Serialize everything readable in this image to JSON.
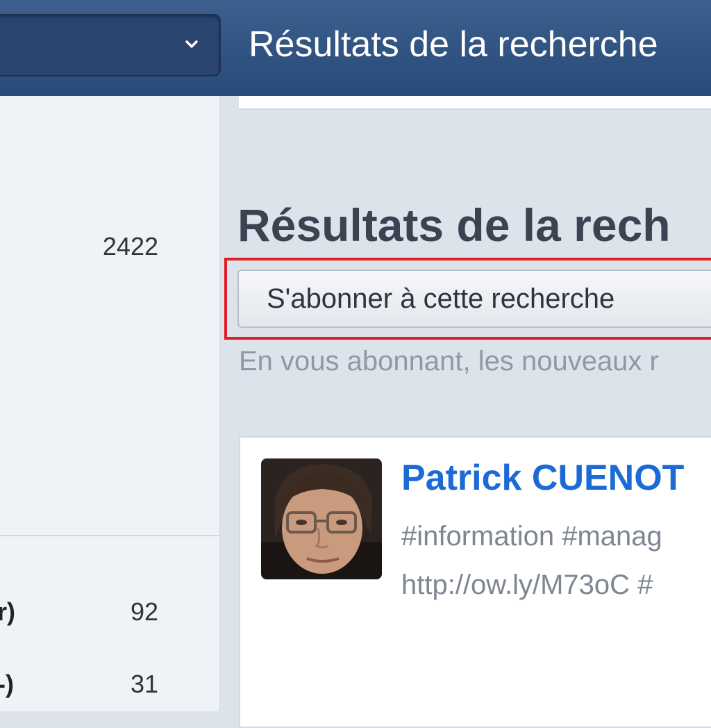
{
  "header": {
    "title": "Résultats de la recherche",
    "dropdown_icon": "chevron-down-icon"
  },
  "sidebar": {
    "total_count": "2422",
    "items": [
      {
        "label": "r)",
        "count": "92"
      },
      {
        "label": "-)",
        "count": "31"
      }
    ]
  },
  "main": {
    "heading": "Résultats de la rech",
    "subscribe_label": "S'abonner à cette recherche",
    "subscribe_hint": "En vous abonnant, les nouveaux r",
    "highlight_color": "#e01e26"
  },
  "result": {
    "author": "Patrick CUENOT",
    "line1": "#information #manag",
    "line2": "http://ow.ly/M73oC #",
    "author_color": "#1c6ad6"
  }
}
